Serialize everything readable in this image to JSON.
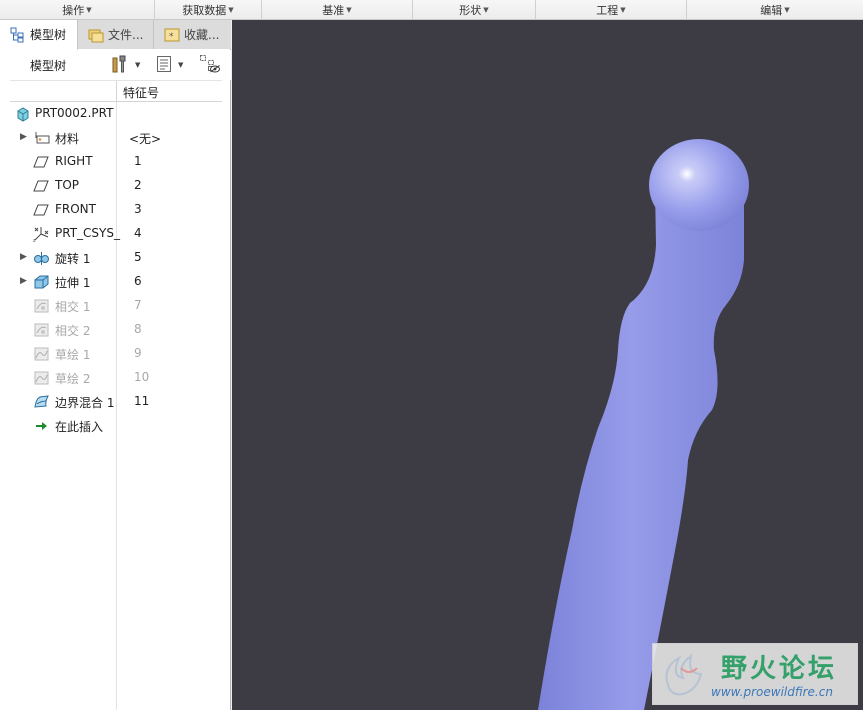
{
  "ribbon": {
    "groups": [
      "操作",
      "获取数据",
      "基准",
      "形状",
      "工程",
      "编辑"
    ]
  },
  "tabs": [
    {
      "label": "模型树",
      "icon": "model-tree-icon"
    },
    {
      "label": "文件...",
      "icon": "folder-browser-icon"
    },
    {
      "label": "收藏...",
      "icon": "favorites-icon"
    }
  ],
  "tree_toolbar": {
    "label": "模型树",
    "icons": [
      "settings-tools-icon",
      "tree-columns-icon",
      "show-hidden-icon"
    ]
  },
  "column_header": "特征号",
  "tree": {
    "root": "PRT0002.PRT",
    "items": [
      {
        "name": "材料",
        "num": "<无>",
        "icon": "material-icon",
        "expandable": true,
        "dim": false
      },
      {
        "name": "RIGHT",
        "num": "1",
        "icon": "datum-plane-icon",
        "expandable": false,
        "dim": false
      },
      {
        "name": "TOP",
        "num": "2",
        "icon": "datum-plane-icon",
        "expandable": false,
        "dim": false
      },
      {
        "name": "FRONT",
        "num": "3",
        "icon": "datum-plane-icon",
        "expandable": false,
        "dim": false
      },
      {
        "name": "PRT_CSYS_",
        "num": "4",
        "icon": "coordinate-system-icon",
        "expandable": false,
        "dim": false
      },
      {
        "name": "旋转 1",
        "num": "5",
        "icon": "revolve-icon",
        "expandable": true,
        "dim": false
      },
      {
        "name": "拉伸 1",
        "num": "6",
        "icon": "extrude-icon",
        "expandable": true,
        "dim": false
      },
      {
        "name": "相交 1",
        "num": "7",
        "icon": "intersect-icon",
        "expandable": false,
        "dim": true
      },
      {
        "name": "相交 2",
        "num": "8",
        "icon": "intersect-icon",
        "expandable": false,
        "dim": true
      },
      {
        "name": "草绘 1",
        "num": "9",
        "icon": "sketch-icon",
        "expandable": false,
        "dim": true
      },
      {
        "name": "草绘 2",
        "num": "10",
        "icon": "sketch-icon",
        "expandable": false,
        "dim": true
      },
      {
        "name": "边界混合 1",
        "num": "11",
        "icon": "boundary-blend-icon",
        "expandable": false,
        "dim": false
      },
      {
        "name": "在此插入",
        "num": "",
        "icon": "insert-here-arrow-icon",
        "expandable": false,
        "dim": false
      }
    ]
  },
  "watermark": {
    "title": "野火论坛",
    "url": "www.proewildfire.cn"
  },
  "colors": {
    "viewport_bg": "#3d3c44",
    "model_fill": "#8f95e6",
    "watermark_green": "#34a06a"
  }
}
